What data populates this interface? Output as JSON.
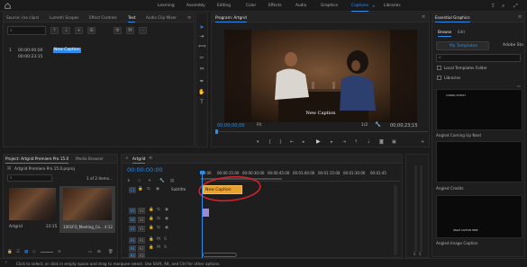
{
  "workspaces": [
    "Learning",
    "Assembly",
    "Editing",
    "Color",
    "Effects",
    "Audio",
    "Graphics",
    "Captions",
    "Libraries"
  ],
  "active_workspace": "Captions",
  "source_panel": {
    "tabs": [
      "Source: (no clips)",
      "Lumetri Scopes",
      "Effect Controls",
      "Text",
      "Audio Clip Mixer"
    ],
    "active_tab": "Text",
    "caption_index": "1",
    "caption_start": "00:00:00:00",
    "caption_end": "00:00:23:15",
    "caption_text": "New Caption"
  },
  "program_monitor": {
    "title": "Program: Artgrid",
    "caption_overlay": "New Caption",
    "timecode": "00;00;00;00",
    "fit": "Fit",
    "resolution": "1/2",
    "duration": "00;00;23;15"
  },
  "project_panel": {
    "tabs": [
      "Project: Artgrid Premiere Pro 15.0",
      "Media Browser"
    ],
    "file_name": "Artgrid Premiere Pro 15.0.prproj",
    "selection_count": "1 of 2 items...",
    "items": [
      {
        "name": "Artgrid",
        "duration": "23:15"
      },
      {
        "name": "1001FO_Meeting_Co...",
        "duration": "4:12"
      }
    ]
  },
  "timeline": {
    "title": "Artgrid",
    "timecode": "00:00:00:00",
    "ruler": [
      "00:00",
      "00:00:15:00",
      "00:00:30:00",
      "00:00:45:00",
      "00:01:00:00",
      "00:01:15:00",
      "00:01:30:00",
      "00:01:45"
    ],
    "subtitle_track_label": "Subtitle",
    "caption_clip": "New Caption",
    "video_tracks": [
      "V3",
      "V2",
      "V1"
    ],
    "audio_tracks": [
      "A1",
      "A2",
      "A3"
    ]
  },
  "essential_graphics": {
    "title": "Essential Graphics",
    "tabs": [
      "Browse",
      "Edit"
    ],
    "my_templates": "My Templates",
    "adobe_stock": "Adobe Sto",
    "local_folder": "Local Templates Folder",
    "libraries": "Libraries",
    "templates": [
      "Angled Coming Up Next",
      "Angled Credits",
      "Angled Image Caption"
    ],
    "template_preview_texts": [
      "COMING UP NEXT",
      "",
      "IMAGE CAPTION HERE"
    ]
  },
  "status": {
    "hint": "Click to select, or click in empty space and drag to marquee select. Use Shift, Alt, and Ctrl for other options."
  },
  "colors": {
    "accent": "#2d8ceb",
    "caption_clip": "#e9a131",
    "highlight_circle": "#d2232a",
    "purple_clip": "#9d86d6"
  }
}
